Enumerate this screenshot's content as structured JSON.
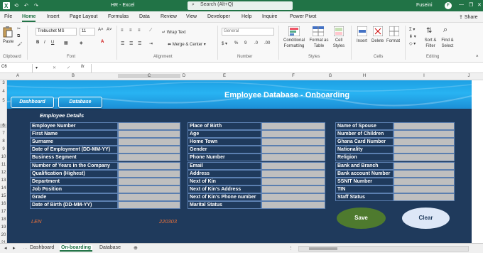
{
  "titlebar": {
    "doc_title": "HR  -  Excel",
    "search_placeholder": "Search (Alt+Q)",
    "user_name": "Fuseini",
    "user_initial": "F"
  },
  "ribbon_tabs": [
    "File",
    "Home",
    "Insert",
    "Page Layout",
    "Formulas",
    "Data",
    "Review",
    "View",
    "Developer",
    "Help",
    "Inquire",
    "Power Pivot"
  ],
  "share_label": "Share",
  "ribbon": {
    "paste": "Paste",
    "font_name": "Trebuchet MS",
    "font_size": "11",
    "wrap_text": "Wrap Text",
    "merge_center": "Merge & Center",
    "number_format": "General",
    "conditional_formatting": "Conditional Formatting",
    "format_as_table": "Format as Table",
    "cell_styles": "Cell Styles",
    "insert": "Insert",
    "delete": "Delete",
    "format": "Format",
    "sort_filter": "Sort & Filter",
    "find_select": "Find & Select",
    "groups": [
      "Clipboard",
      "Font",
      "Alignment",
      "Number",
      "Styles",
      "Cells",
      "Editing"
    ]
  },
  "formula_bar": {
    "name_box": "C6",
    "fx": "fx",
    "content": ""
  },
  "column_headers": [
    "A",
    "B",
    "C",
    "D",
    "E",
    "F",
    "G",
    "H",
    "I",
    "J"
  ],
  "row_headers": [
    "3",
    "4",
    "5",
    "6",
    "7",
    "8",
    "9",
    "10",
    "11",
    "12",
    "13",
    "14",
    "15",
    "16",
    "17",
    "18",
    "19",
    "20",
    "21",
    "22",
    "23"
  ],
  "form": {
    "title": "Employee Database - Onboarding",
    "nav": {
      "dashboard": "Dashboard",
      "database": "Database"
    },
    "section_title": "Employee Details",
    "col1": [
      "Employee Number",
      "First Name",
      "Surname",
      "Date of Employment (DD-MM-YY)",
      "Business Segment",
      "Number of Years in the Company",
      "Qualification (Highest)",
      "Department",
      "Job Position",
      "Grade",
      "Date of Birth (DD-MM-YY)"
    ],
    "col2": [
      "Place of Birth",
      "Age",
      "Home Town",
      "Gender",
      "Phone Number",
      "Email",
      "Address",
      "Next of Kin",
      "Next of Kin's Address",
      "Next of Kin's Phone number",
      "Marital Status"
    ],
    "col3": [
      "Name of Spouse",
      "Number of Children",
      "Ghana Card Number",
      "Nationality",
      "Religion",
      "Bank and Branch",
      "Bank account Number",
      "SSNIT Number",
      "TIN",
      "Staff Status"
    ],
    "save_label": "Save",
    "clear_label": "Clear",
    "len_label": "LEN",
    "len_value": "220303"
  },
  "sheet_tabs": [
    "Dashboard",
    "On-boarding",
    "Database"
  ],
  "colors": {
    "excel_green": "#217346",
    "sheet_bg": "#1f3a5c",
    "banner": "#1ea0e4",
    "save_btn": "#4e7a2e",
    "clear_btn": "#dde7f7",
    "len_color": "#e8703a"
  }
}
